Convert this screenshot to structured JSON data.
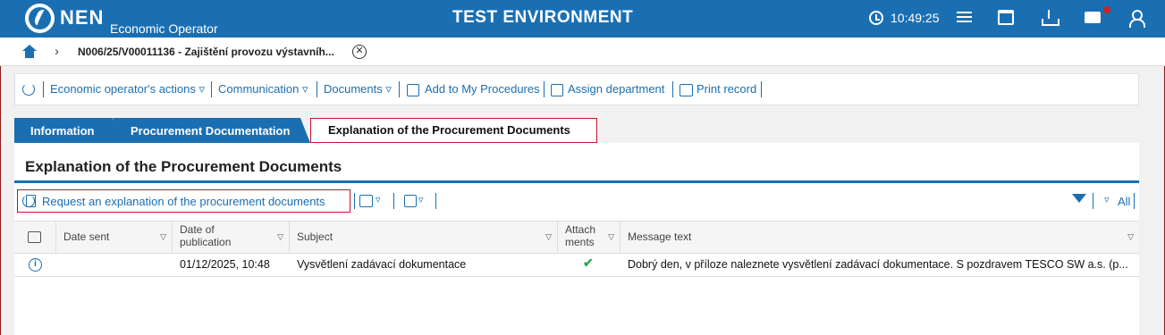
{
  "header": {
    "logo_text": "NEN",
    "logo_subtitle": "Economic Operator",
    "environment": "TEST ENVIRONMENT",
    "time": "10:49:25",
    "accent": "#1a6fb3",
    "notification_color": "#d0201f",
    "icons": [
      "clock-icon",
      "menu-icon",
      "calendar-icon",
      "download-icon",
      "mail-icon",
      "user-icon"
    ]
  },
  "breadcrumb": {
    "current": "N006/25/V00011136 - Zajištění provozu výstavníh..."
  },
  "actions": {
    "economic_operator": "Economic operator's actions",
    "communication": "Communication",
    "documents": "Documents",
    "add_procedures": "Add to My Procedures",
    "assign_department": "Assign department",
    "print_record": "Print record",
    "caret": "▿"
  },
  "tabs": [
    {
      "label": "Information"
    },
    {
      "label": "Procurement Documentation"
    },
    {
      "label": "Explanation of the Procurement Documents",
      "active": true
    }
  ],
  "panel": {
    "title": "Explanation of the Procurement Documents",
    "request_button": "Request an explanation of the procurement documents",
    "filter_all": "All"
  },
  "table": {
    "columns": [
      "Date sent",
      "Date of publication",
      "Subject",
      "Attachments",
      "Message text"
    ],
    "col_date_pub_line1": "Date of",
    "col_date_pub_line2": "publication",
    "col_attach_line1": "Attach",
    "col_attach_line2": "ments",
    "rows": [
      {
        "date_sent": "",
        "date_publication": "01/12/2025, 10:48",
        "subject": "Vysvětlení zadávací dokumentace",
        "attachments": "✔",
        "message": "Dobrý den, v příloze naleznete vysvětlení zadávací dokumentace. S pozdravem TESCO SW a.s. (p..."
      }
    ]
  }
}
